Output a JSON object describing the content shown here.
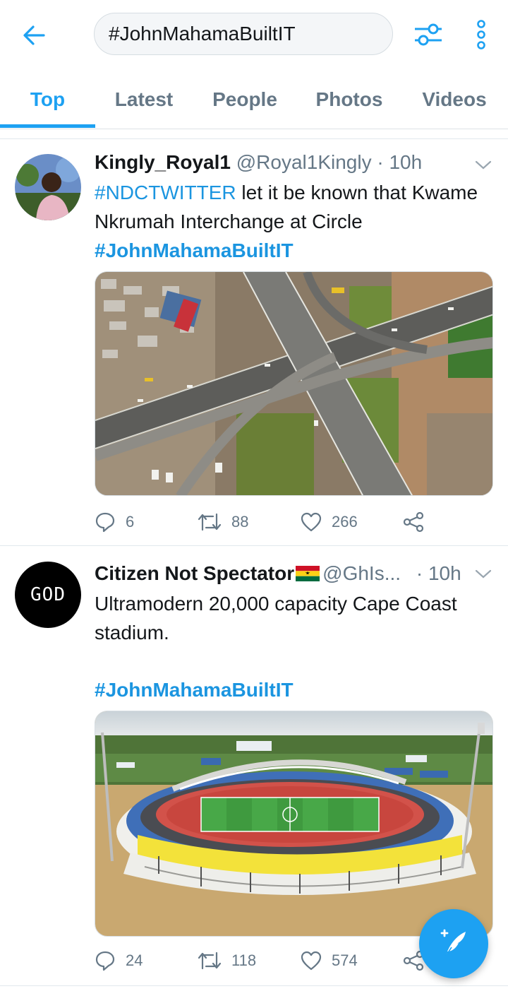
{
  "colors": {
    "accent": "#1da1f2",
    "link": "#1b95e0",
    "muted": "#657786"
  },
  "search": {
    "query": "#JohnMahamaBuiltIT"
  },
  "icons": {
    "back": "arrow-left-icon",
    "filter": "sliders-icon",
    "more": "more-vertical-icon",
    "compose": "compose-tweet-icon"
  },
  "tabs": [
    {
      "label": "Top",
      "active": true
    },
    {
      "label": "Latest"
    },
    {
      "label": "People"
    },
    {
      "label": "Photos"
    },
    {
      "label": "Videos"
    }
  ],
  "tweets": [
    {
      "name": "Kingly_Royal1",
      "handle": "@Royal1Kingly",
      "sep": " · ",
      "time": "10h",
      "hashtag_lead": "#NDCTWITTER",
      "text": " let it be known that Kwame Nkrumah Interchange at Circle",
      "hashtag_tail": "#JohnMahamaBuiltIT",
      "image": "aerial photo of highway interchange",
      "replies": "6",
      "retweets": "88",
      "likes": "266"
    },
    {
      "name": "Citizen Not Spectator",
      "handle": "@GhIs...",
      "sep": " · ",
      "time": "10h",
      "avatar_text": "GOD",
      "text": "Ultramodern 20,000 capacity Cape Coast stadium.",
      "hashtag_tail": "#JohnMahamaBuiltIT",
      "image": "aerial photo of stadium",
      "replies": "24",
      "retweets": "118",
      "likes": "574"
    }
  ]
}
